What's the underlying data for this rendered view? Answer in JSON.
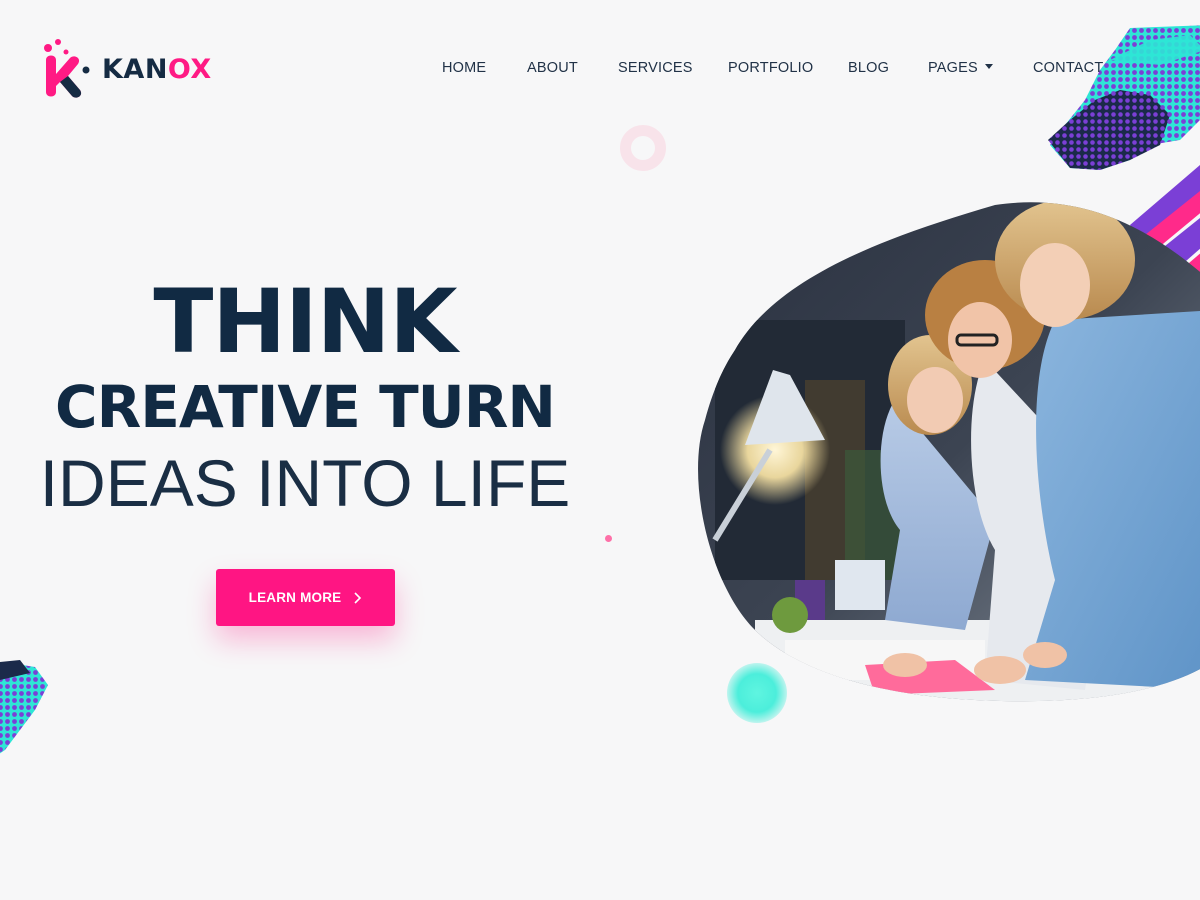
{
  "brand": {
    "name_primary": "KAN",
    "name_accent": "OX",
    "colors": {
      "navy": "#112a43",
      "pink": "#ff1583",
      "teal": "#4ceedb",
      "purple": "#7b3fd6"
    },
    "logo_icon": "k-logo-icon"
  },
  "nav": {
    "items": [
      {
        "label": "HOME"
      },
      {
        "label": "ABOUT"
      },
      {
        "label": "SERVICES"
      },
      {
        "label": "PORTFOLIO"
      },
      {
        "label": "BLOG"
      },
      {
        "label": "PAGES",
        "dropdown_icon": "caret-down-icon"
      },
      {
        "label": "CONTACT"
      }
    ]
  },
  "hero": {
    "line1": "THINK",
    "line2": "CREATIVE TURN",
    "line3": "IDEAS INTO LIFE",
    "cta_label": "LEARN MORE",
    "cta_icon": "chevron-right-icon",
    "image": "team-working-photo"
  }
}
